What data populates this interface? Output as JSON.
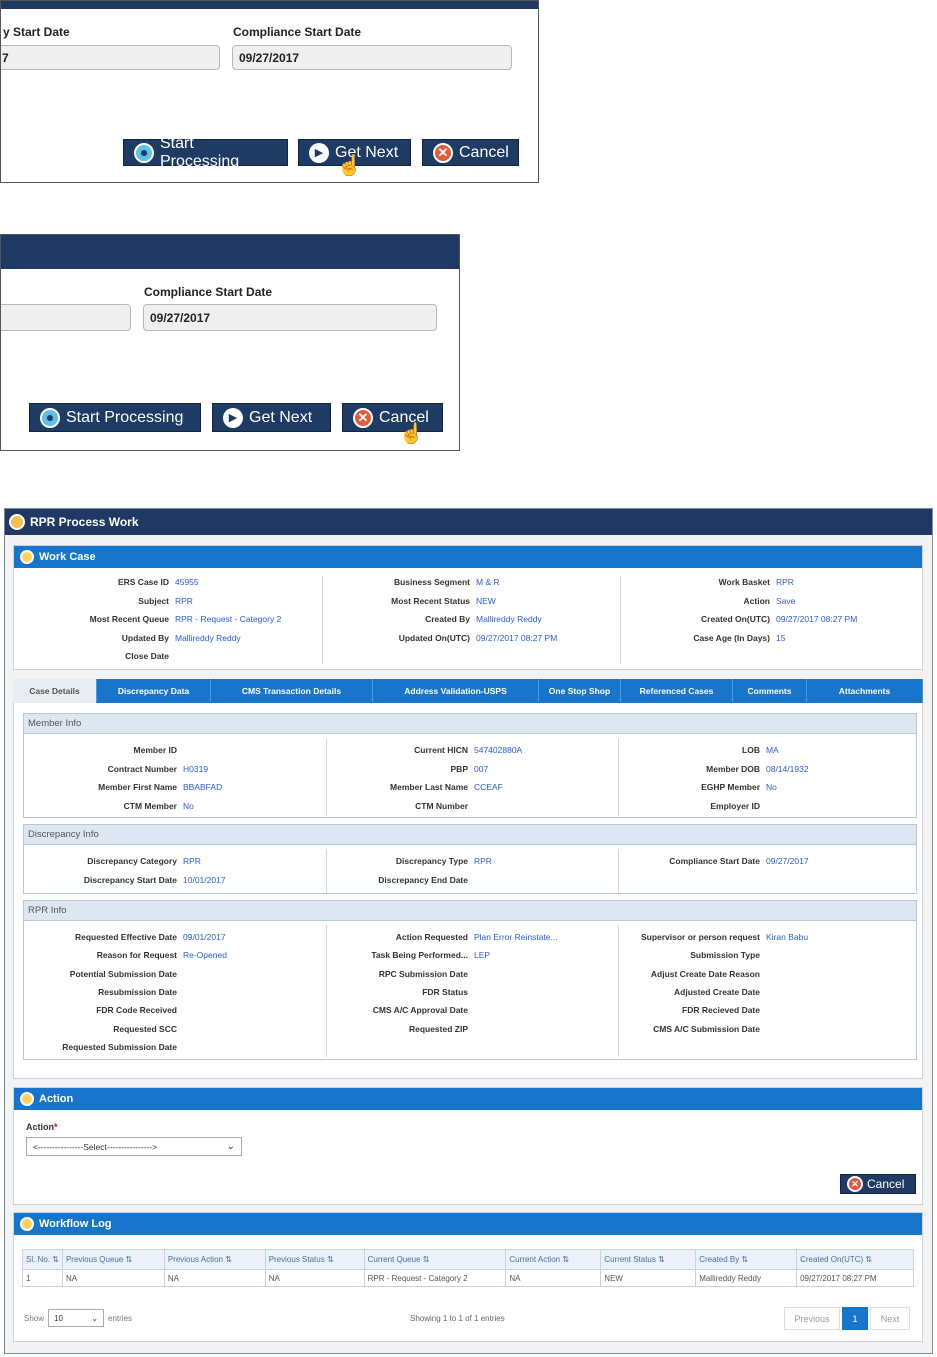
{
  "snippet1": {
    "label_left": "y Start Date",
    "value_left": "7",
    "label_right": "Compliance Start Date",
    "value_right": "09/27/2017",
    "buttons": {
      "start": "Start Processing",
      "next": "Get Next",
      "cancel": "Cancel"
    }
  },
  "snippet2": {
    "label_right": "Compliance Start Date",
    "value_right": "09/27/2017",
    "buttons": {
      "start": "Start Processing",
      "next": "Get Next",
      "cancel": "Cancel"
    }
  },
  "app": {
    "title": "RPR Process Work",
    "work_case": {
      "title": "Work Case",
      "col1": [
        {
          "k": "ERS Case ID",
          "v": "45955"
        },
        {
          "k": "Subject",
          "v": "RPR"
        },
        {
          "k": "Most Recent Queue",
          "v": "RPR - Request - Category 2"
        },
        {
          "k": "Updated By",
          "v": "Mallireddy Reddy"
        },
        {
          "k": "Close Date",
          "v": ""
        }
      ],
      "col2": [
        {
          "k": "Business Segment",
          "v": "M & R"
        },
        {
          "k": "Most Recent Status",
          "v": "NEW"
        },
        {
          "k": "Created By",
          "v": "Mallireddy Reddy"
        },
        {
          "k": "Updated On(UTC)",
          "v": "09/27/2017 08:27 PM"
        }
      ],
      "col3": [
        {
          "k": "Work Basket",
          "v": "RPR"
        },
        {
          "k": "Action",
          "v": "Save"
        },
        {
          "k": "Created On(UTC)",
          "v": "09/27/2017 08:27 PM"
        },
        {
          "k": "Case Age (In Days)",
          "v": "15"
        }
      ]
    },
    "tabs": [
      "Case Details",
      "Discrepancy Data",
      "CMS Transaction Details",
      "Address Validation-USPS",
      "One Stop Shop",
      "Referenced Cases",
      "Comments",
      "Attachments"
    ],
    "member_info": {
      "title": "Member Info",
      "col1": [
        {
          "k": "Member ID",
          "v": ""
        },
        {
          "k": "Contract Number",
          "v": "H0319"
        },
        {
          "k": "Member First Name",
          "v": "BBABFAD"
        },
        {
          "k": "CTM Member",
          "v": "No"
        }
      ],
      "col2": [
        {
          "k": "Current HICN",
          "v": "547402880A"
        },
        {
          "k": "PBP",
          "v": "007"
        },
        {
          "k": "Member Last Name",
          "v": "CCEAF"
        },
        {
          "k": "CTM Number",
          "v": ""
        }
      ],
      "col3": [
        {
          "k": "LOB",
          "v": "MA"
        },
        {
          "k": "Member DOB",
          "v": "08/14/1932"
        },
        {
          "k": "EGHP Member",
          "v": "No"
        },
        {
          "k": "Employer ID",
          "v": ""
        }
      ]
    },
    "discrepancy_info": {
      "title": "Discrepancy Info",
      "col1": [
        {
          "k": "Discrepancy Category",
          "v": "RPR"
        },
        {
          "k": "Discrepancy Start Date",
          "v": "10/01/2017"
        }
      ],
      "col2": [
        {
          "k": "Discrepancy Type",
          "v": "RPR"
        },
        {
          "k": "Discrepancy End Date",
          "v": ""
        }
      ],
      "col3": [
        {
          "k": "Compliance Start Date",
          "v": "09/27/2017"
        }
      ]
    },
    "rpr_info": {
      "title": "RPR Info",
      "col1": [
        {
          "k": "Requested Effective Date",
          "v": "09/01/2017"
        },
        {
          "k": "Reason for Request",
          "v": "Re-Opened"
        },
        {
          "k": "Potential Submission Date",
          "v": ""
        },
        {
          "k": "Resubmission Date",
          "v": ""
        },
        {
          "k": "FDR Code Received",
          "v": ""
        },
        {
          "k": "Requested SCC",
          "v": ""
        },
        {
          "k": "Requested Submission Date",
          "v": ""
        }
      ],
      "col2": [
        {
          "k": "Action Requested",
          "v": "Plan Error Reinstate..."
        },
        {
          "k": "Task Being Performed...",
          "v": "LEP"
        },
        {
          "k": "RPC Submission Date",
          "v": ""
        },
        {
          "k": "FDR Status",
          "v": ""
        },
        {
          "k": "CMS A/C Approval Date",
          "v": ""
        },
        {
          "k": "Requested ZIP",
          "v": ""
        }
      ],
      "col3": [
        {
          "k": "Supervisor or person request",
          "v": "Kiran Babu"
        },
        {
          "k": "Submission Type",
          "v": ""
        },
        {
          "k": "Adjust Create Date Reason",
          "v": ""
        },
        {
          "k": "Adjusted Create Date",
          "v": ""
        },
        {
          "k": "FDR Recieved Date",
          "v": ""
        },
        {
          "k": "CMS A/C Submission Date",
          "v": ""
        }
      ]
    },
    "action": {
      "title": "Action",
      "field_label": "Action",
      "required_mark": "*",
      "select_value": "<----------------Select---------------->",
      "cancel": "Cancel"
    },
    "workflow_log": {
      "title": "Workflow Log",
      "headers": [
        "Sl. No.",
        "Previous Queue",
        "Previous Action",
        "Previous Status",
        "Current Queue",
        "Current Action",
        "Current Status",
        "Created By",
        "Created On(UTC)"
      ],
      "rows": [
        [
          "1",
          "NA",
          "NA",
          "NA",
          "RPR - Request - Category 2",
          "NA",
          "NEW",
          "Mallireddy Reddy",
          "09/27/2017 08:27 PM"
        ]
      ],
      "show_label": "Show",
      "show_value": "10",
      "entries_label": "entries",
      "info": "Showing 1 to 1 of 1 entries",
      "prev": "Previous",
      "page": "1",
      "next": "Next"
    }
  }
}
